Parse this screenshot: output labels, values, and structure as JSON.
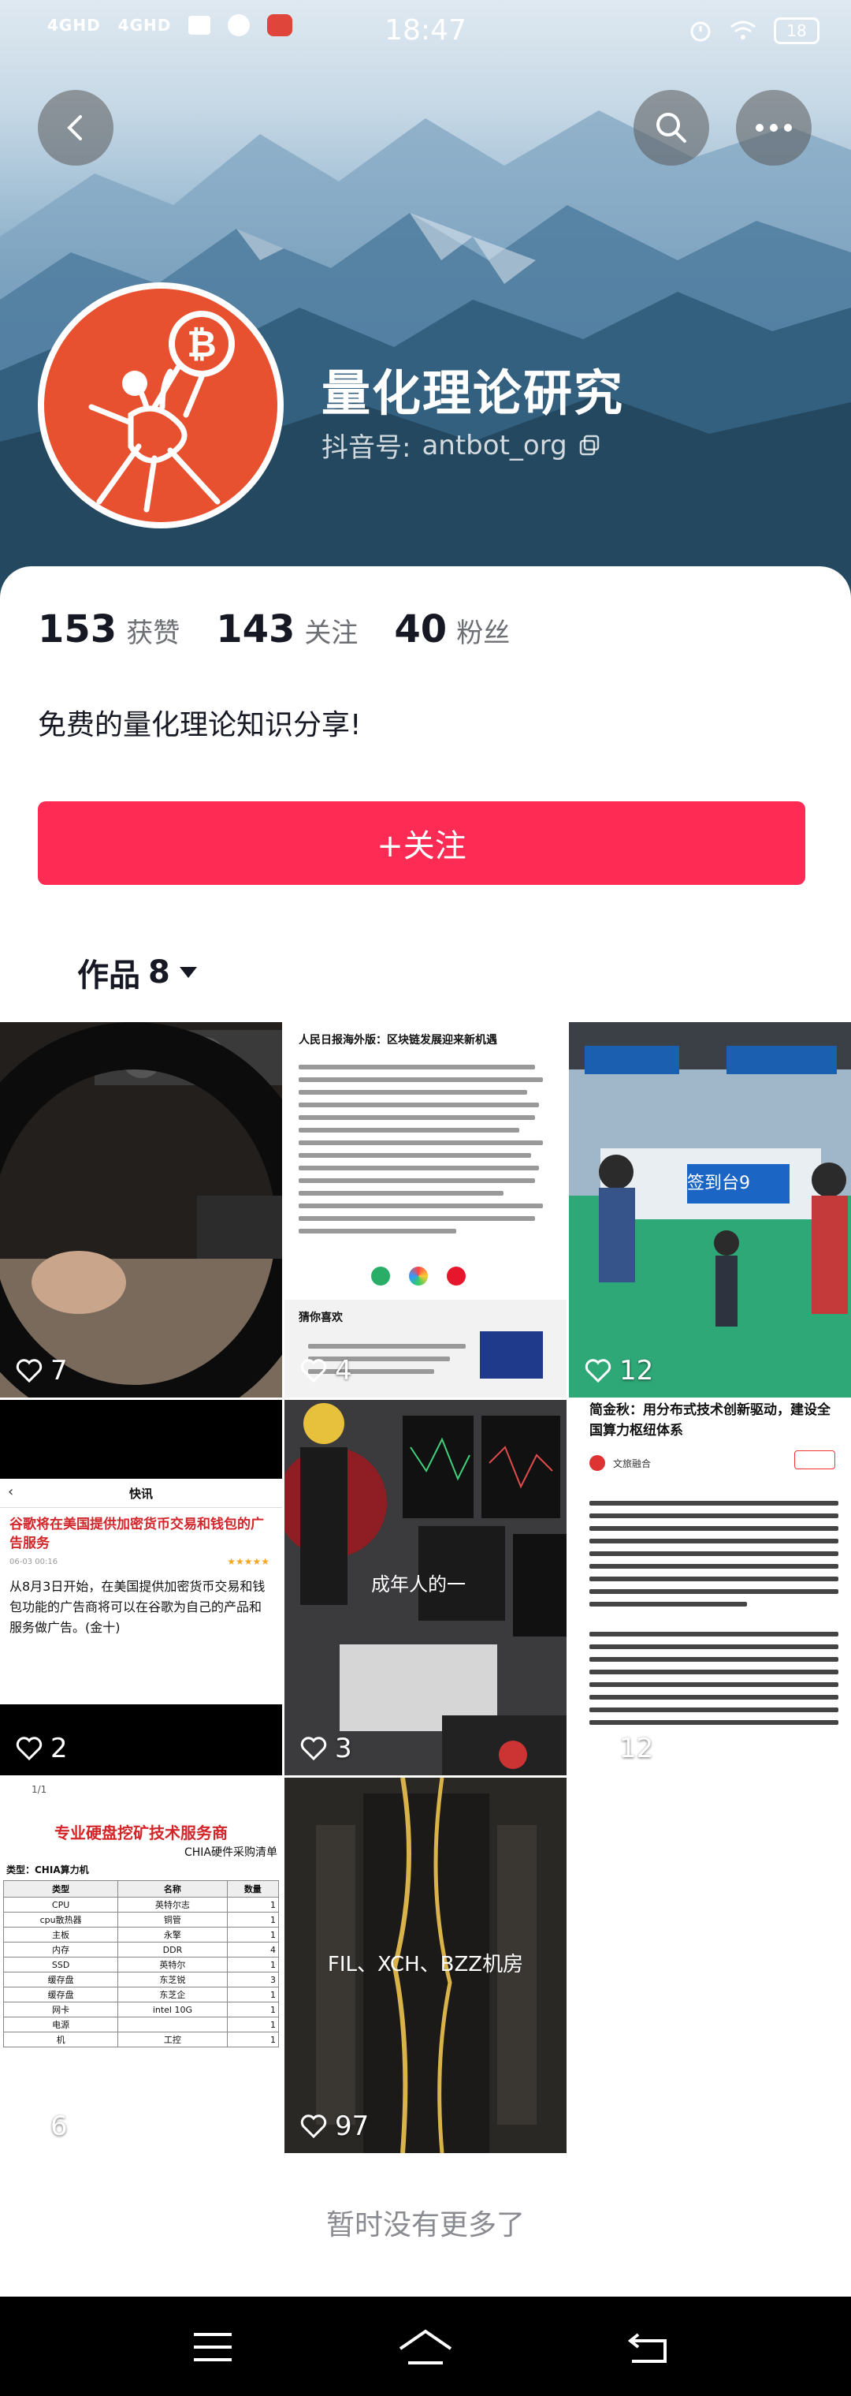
{
  "status_bar": {
    "time": "18:47",
    "network_1": "4GHD",
    "network_2": "4GHD",
    "battery": "18"
  },
  "profile": {
    "name": "量化理论研究",
    "handle_label": "抖音号:",
    "handle": "antbot_org",
    "bio": "免费的量化理论知识分享!"
  },
  "stats": [
    {
      "num": "153",
      "label": "获赞"
    },
    {
      "num": "143",
      "label": "关注"
    },
    {
      "num": "40",
      "label": "粉丝"
    }
  ],
  "follow_button": "+关注",
  "works_tab": {
    "label": "作品",
    "count": "8"
  },
  "posts": [
    {
      "likes": "7"
    },
    {
      "likes": "4",
      "title": "人民日报海外版：区块链发展迎来新机遇",
      "footer": "猜你喜欢"
    },
    {
      "likes": "12",
      "overlay": "签到台9"
    },
    {
      "likes": "2",
      "header": "快讯",
      "headline": "谷歌将在美国提供加密货币交易和钱包的广告服务",
      "date": "06-03 00:16",
      "body": "从8月3日开始，在美国提供加密货币交易和钱包功能的广告商将可以在谷歌为自己的产品和服务做广告。(金十)"
    },
    {
      "likes": "3",
      "overlay": "成年人的一"
    },
    {
      "likes": "12",
      "headline": "简金秋：用分布式技术创新驱动，建设全国算力枢纽体系",
      "source": "文旅融合"
    },
    {
      "likes": "6",
      "page": "1/1",
      "headline": "专业硬盘挖矿技术服务商",
      "subheader": "CHIA硬件采购清单",
      "type": "类型：CHIA算力机",
      "columns": [
        "类型",
        "名称",
        "数量"
      ],
      "rows": [
        [
          "CPU",
          "英特尔志",
          "1"
        ],
        [
          "cpu散热器",
          "铜管",
          "1"
        ],
        [
          "主板",
          "永擎",
          "1"
        ],
        [
          "内存",
          "DDR",
          "4"
        ],
        [
          "SSD",
          "英特尔",
          "1"
        ],
        [
          "缓存盘",
          "东芝锐",
          "3"
        ],
        [
          "缓存盘",
          "东芝企",
          "1"
        ],
        [
          "网卡",
          "intel 10G",
          "1"
        ],
        [
          "电源",
          "",
          "1"
        ],
        [
          "机",
          "工控",
          "1"
        ]
      ]
    },
    {
      "likes": "97",
      "overlay": "FIL、XCH、BZZ机房"
    }
  ],
  "no_more_text": "暂时没有更多了",
  "colors": {
    "accent": "#fe2c55",
    "avatar_bg": "#e8512f",
    "text": "#161823"
  }
}
